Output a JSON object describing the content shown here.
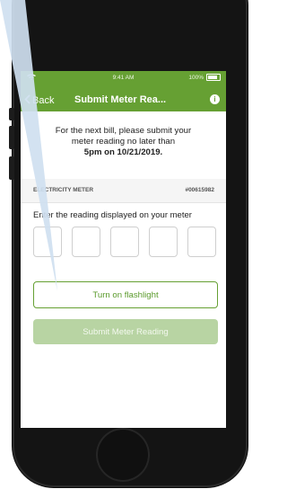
{
  "status_bar": {
    "time": "9:41 AM",
    "battery": "100%",
    "battery_level": 1.0
  },
  "nav": {
    "back_label": "Back",
    "title": "Submit Meter Rea..."
  },
  "notice": {
    "line1": "For the next bill, please submit your",
    "line2": "meter reading no later than",
    "deadline": "5pm on 10/21/2019."
  },
  "meter": {
    "label": "ELECTRICITY METER",
    "number": "#00615982"
  },
  "reading": {
    "prompt": "Enter the reading displayed on your meter",
    "digits": [
      "",
      "",
      "",
      "",
      ""
    ]
  },
  "buttons": {
    "flashlight": "Turn on flashlight",
    "submit": "Submit Meter Reading"
  },
  "colors": {
    "brand_green": "#66a033",
    "disabled_green": "#b8d4a3",
    "callout_blue": "#cfe0f0"
  },
  "icons": {
    "back": "chevron-left-icon",
    "info": "info-icon",
    "wifi": "wifi-icon",
    "battery": "battery-icon"
  }
}
